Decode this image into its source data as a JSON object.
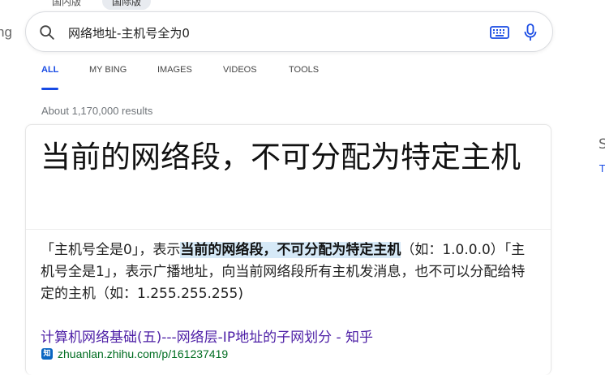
{
  "top_tabs": [
    "国内版",
    "国际版"
  ],
  "logo_fragment": "ng",
  "search": {
    "query": "网络地址-主机号全为0"
  },
  "nav": {
    "tabs": [
      "ALL",
      "MY BING",
      "IMAGES",
      "VIDEOS",
      "TOOLS"
    ],
    "active": "ALL"
  },
  "result_count": "About 1,170,000 results",
  "answer": {
    "title": "当前的网络段，不可分配为特定主机",
    "snippet_before": "「主机号全是0」，表示",
    "snippet_highlight": "当前的网络段，不可分配为特定主机",
    "snippet_after": "（如：1.0.0.0）「主机号全是1」，表示广播地址，向当前网络段所有主机发消息，也不可以分配给特定的主机（如：1.255.255.255)",
    "source_title": "计算机网络基础(五)---网络层-IP地址的子网划分 - 知乎",
    "source_url": "zhuanlan.zhihu.com/p/161237419",
    "source_icon_label": "知"
  },
  "right_fragments": [
    "S",
    "T"
  ],
  "colors": {
    "accent": "#174ae4",
    "visited_link": "#4d1fa6",
    "url_green": "#006d21",
    "highlight": "#d6e9f7"
  },
  "icons": [
    "search-icon",
    "keyboard-icon",
    "microphone-icon",
    "zhihu-icon"
  ]
}
